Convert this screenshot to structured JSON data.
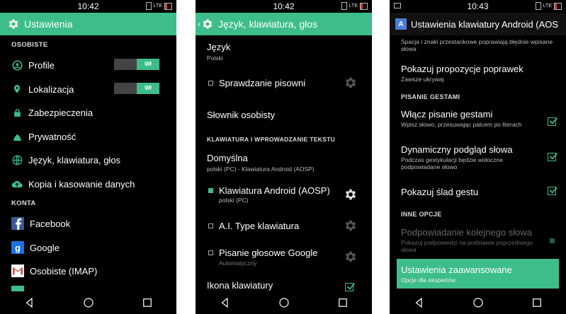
{
  "phone1": {
    "time": "10:42",
    "lte": "LTE",
    "title": "Ustawienia",
    "sections": {
      "personal": "OSOBISTE",
      "accounts": "KONTA"
    },
    "items": [
      {
        "label": "Profile",
        "toggle": "Wł"
      },
      {
        "label": "Lokalizacja",
        "toggle": "Wł"
      },
      {
        "label": "Zabezpieczenia"
      },
      {
        "label": "Prywatność"
      },
      {
        "label": "Język, klawiatura, głos"
      },
      {
        "label": "Kopia i kasowanie danych"
      }
    ],
    "accounts": [
      {
        "label": "Facebook"
      },
      {
        "label": "Google"
      },
      {
        "label": "Osobiste (IMAP)"
      }
    ]
  },
  "phone2": {
    "time": "10:42",
    "lte": "LTE",
    "title": "Język, klawiatura, głos",
    "language": {
      "title": "Język",
      "sub": "Polski"
    },
    "spell": "Sprawdzanie pisowni",
    "dictionary": "Słownik osobisty",
    "section": "KLAWIATURA I WPROWADZANIE TEKSTU",
    "default": {
      "title": "Domyślna",
      "sub": "polski (PC) - Klawiatura Android (AOSP)"
    },
    "aosp": {
      "title": "Klawiatura Android (AOSP)",
      "sub": "polski (PC)"
    },
    "ai": "A.I. Type klawiatura",
    "voice": {
      "title": "Pisanie głosowe Google",
      "sub": "Automatyczny"
    },
    "icon": "Ikona klawiatury"
  },
  "phone3": {
    "time": "10:43",
    "lte": "LTE",
    "title": "Ustawienia klawiatury Android (AOS",
    "top_sub": "Spacja i znaki przestankowe poprawiają błędnie wpisane słowa",
    "suggest": {
      "title": "Pokazuj propozycje poprawek",
      "sub": "Zawsze ukrywaj"
    },
    "section_gesture": "PISANIE GESTAMI",
    "gesture": {
      "title": "Włącz pisanie gestami",
      "sub": "Wpisz słowo, przesuwając palcem po literach"
    },
    "preview": {
      "title": "Dynamiczny podgląd słowa",
      "sub": "Podczas gestykulacji będzie widoczne podpowiadane słowo"
    },
    "trail": {
      "title": "Pokazuj ślad gestu"
    },
    "section_other": "INNE OPCJE",
    "next": {
      "title": "Podpowiadanie kolejnego słowa",
      "sub": "Pokazuj podpowiedzi na podstawie poprzedniego słowa"
    },
    "advanced": {
      "title": "Ustawienia zaawansowane",
      "sub": "Opcje dla ekspertów"
    }
  },
  "colors": {
    "accent": "#3dbd8a",
    "background": "#000000"
  }
}
